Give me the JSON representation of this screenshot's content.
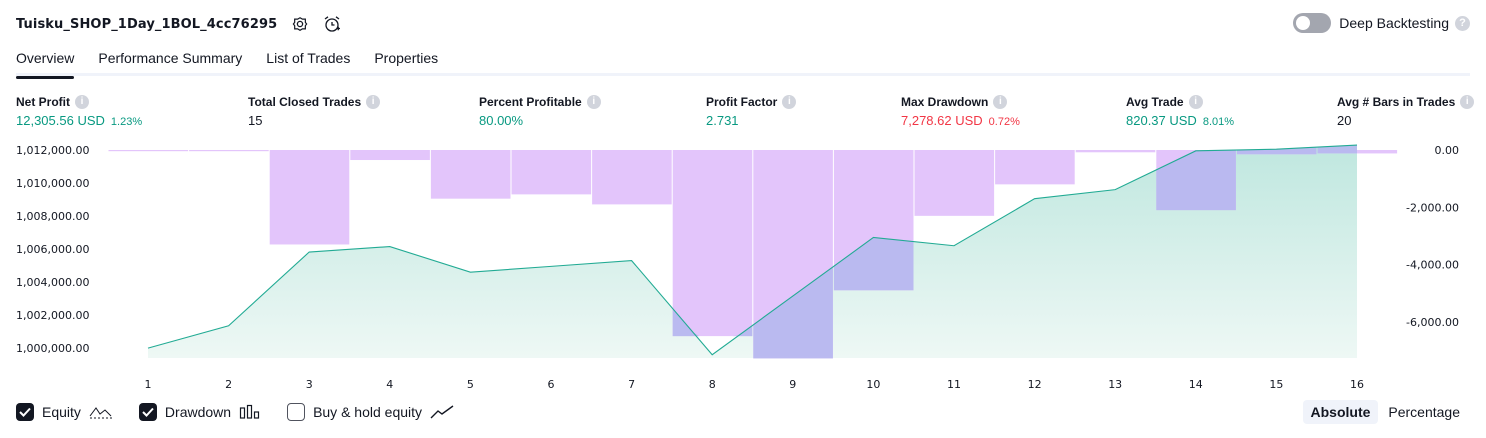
{
  "header": {
    "title": "Tuisku_SHOP_1Day_1BOL_4cc76295",
    "settings_icon": "gear-icon",
    "alert_icon": "alarm-clock-plus-icon",
    "deep_backtesting_label": "Deep Backtesting",
    "help_glyph": "?"
  },
  "tabs": [
    {
      "label": "Overview",
      "active": true
    },
    {
      "label": "Performance Summary",
      "active": false
    },
    {
      "label": "List of Trades",
      "active": false
    },
    {
      "label": "Properties",
      "active": false
    }
  ],
  "metrics": [
    {
      "label": "Net Profit",
      "value": "12,305.56 USD",
      "pct": "1.23%",
      "color": "green"
    },
    {
      "label": "Total Closed Trades",
      "value": "15",
      "pct": "",
      "color": "black"
    },
    {
      "label": "Percent Profitable",
      "value": "80.00%",
      "pct": "",
      "color": "green"
    },
    {
      "label": "Profit Factor",
      "value": "2.731",
      "pct": "",
      "color": "green"
    },
    {
      "label": "Max Drawdown",
      "value": "7,278.62 USD",
      "pct": "0.72%",
      "color": "red"
    },
    {
      "label": "Avg Trade",
      "value": "820.37 USD",
      "pct": "8.01%",
      "color": "green"
    },
    {
      "label": "Avg # Bars in Trades",
      "value": "20",
      "pct": "",
      "color": "black"
    }
  ],
  "info_glyph": "i",
  "chart_data": {
    "type": "area",
    "x": [
      1,
      2,
      3,
      4,
      5,
      6,
      7,
      8,
      9,
      10,
      11,
      12,
      13,
      14,
      15,
      16
    ],
    "series": [
      {
        "name": "Equity",
        "kind": "area",
        "axis": "left",
        "values": [
          1000000,
          1001350,
          1005820,
          1006150,
          1004600,
          1004950,
          1005300,
          999600,
          1003150,
          1006700,
          1006200,
          1009050,
          1009600,
          1011950,
          1012050,
          1012300
        ]
      },
      {
        "name": "Drawdown",
        "kind": "bar",
        "axis": "right",
        "values": [
          -30,
          -30,
          -3300,
          -350,
          -1700,
          -1550,
          -1900,
          -6500,
          -7278.62,
          -4900,
          -2300,
          -1200,
          -80,
          -2100,
          -150,
          -120
        ]
      }
    ],
    "left_axis": {
      "ticks": [
        "1,000,000.00",
        "1,002,000.00",
        "1,004,000.00",
        "1,006,000.00",
        "1,008,000.00",
        "1,010,000.00",
        "1,012,000.00"
      ],
      "tick_values": [
        1000000,
        1002000,
        1004000,
        1006000,
        1008000,
        1010000,
        1012000
      ],
      "range": [
        999400,
        1012000
      ]
    },
    "right_axis": {
      "ticks": [
        "0.00",
        "-2,000.00",
        "-4,000.00",
        "-6,000.00"
      ],
      "tick_values": [
        0,
        -2000,
        -4000,
        -6000
      ],
      "range": [
        -7300,
        0
      ]
    },
    "x_ticks": [
      "1",
      "2",
      "3",
      "4",
      "5",
      "6",
      "7",
      "8",
      "9",
      "10",
      "11",
      "12",
      "13",
      "14",
      "15",
      "16"
    ],
    "colors": {
      "equity_line": "#22ab94",
      "equity_fill_top": "#bfe7df",
      "equity_fill_bottom": "#eef8f5",
      "drawdown_bar": "#e1c2fb",
      "overlap": "#b6b8ee"
    },
    "grid": false
  },
  "legend": {
    "items": [
      {
        "label": "Equity",
        "checked": true,
        "icon": "equity-line-icon"
      },
      {
        "label": "Drawdown",
        "checked": true,
        "icon": "drawdown-bars-icon"
      },
      {
        "label": "Buy & hold equity",
        "checked": false,
        "icon": "buy-hold-line-icon"
      }
    ]
  },
  "mode": {
    "absolute": "Absolute",
    "percentage": "Percentage",
    "selected": "Absolute"
  }
}
